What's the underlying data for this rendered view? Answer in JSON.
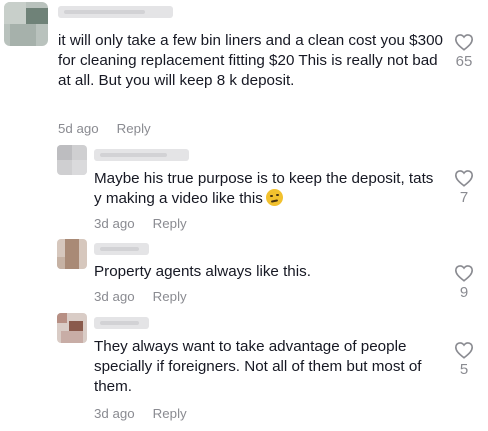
{
  "comments": [
    {
      "text": "it will only take a few bin liners and a clean cost you $300 for cleaning replacement fitting $20 This is really not bad at all. But you will keep 8 k deposit.",
      "time": "5d ago",
      "reply_label": "Reply",
      "likes": "65",
      "icon": "heart-outline-icon"
    },
    {
      "text": "Maybe his true purpose is to keep the deposit, tats y making a video like this",
      "emoji": "thinking-face-emoji",
      "time": "3d ago",
      "reply_label": "Reply",
      "likes": "7",
      "icon": "heart-outline-icon"
    },
    {
      "text": "Property agents always like this.",
      "time": "3d ago",
      "reply_label": "Reply",
      "likes": "9",
      "icon": "heart-outline-icon"
    },
    {
      "text": "They always want to take advantage of people specially if foreigners. Not all of them but most of them.",
      "time": "3d ago",
      "reply_label": "Reply",
      "likes": "5",
      "icon": "heart-outline-icon"
    }
  ],
  "colors": {
    "text": "#161823",
    "meta": "#8a8b91",
    "heart_outline": "#8a8b91",
    "emoji": "#f2c12e"
  }
}
